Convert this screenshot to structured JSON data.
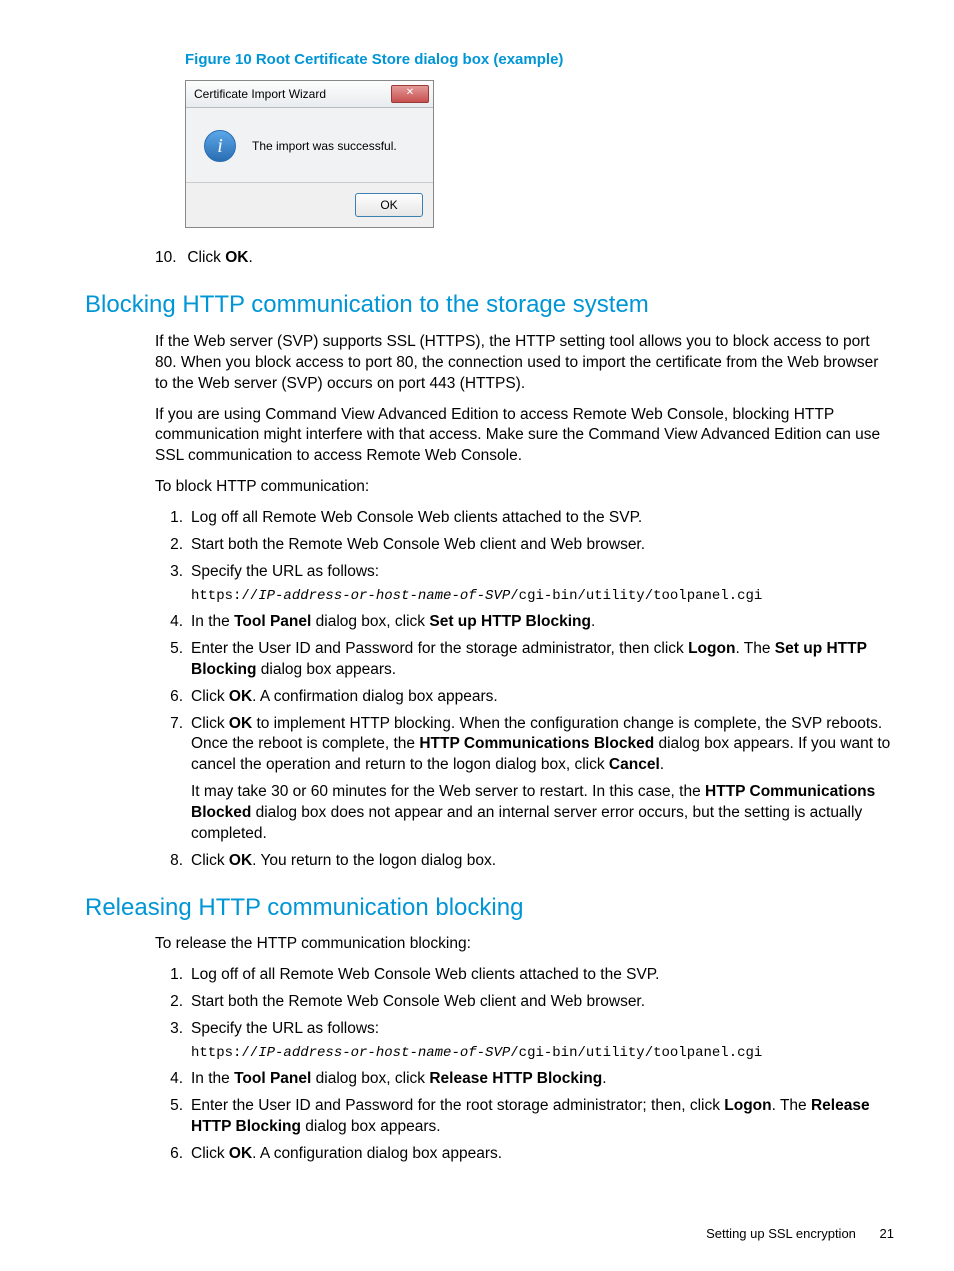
{
  "figure": {
    "caption": "Figure 10 Root Certificate Store dialog box (example)",
    "dialog_title": "Certificate Import Wizard",
    "dialog_message": "The import was successful.",
    "ok_label": "OK"
  },
  "step10": {
    "num": "10.",
    "text_prefix": "Click ",
    "bold": "OK",
    "text_suffix": "."
  },
  "section1": {
    "heading": "Blocking HTTP communication to the storage system",
    "para1": "If the Web server (SVP) supports SSL (HTTPS), the HTTP setting tool allows you to block access to port 80. When you block access to port 80, the connection used to import the certificate from the Web browser to the Web server (SVP) occurs on port 443 (HTTPS).",
    "para2": "If you are using Command View Advanced Edition to access Remote Web Console, blocking HTTP communication might interfere with that access. Make sure the Command View Advanced Edition can use SSL communication to access Remote Web Console.",
    "para3": "To block HTTP communication:",
    "steps": {
      "s1": "Log off all Remote Web Console Web clients attached to the SVP.",
      "s2": "Start both the Remote Web Console Web client and Web browser.",
      "s3_text": "Specify the URL as follows:",
      "s3_url_prefix": "https://",
      "s3_url_italic": "IP-address-or-host-name-of-SVP",
      "s3_url_suffix": "/cgi-bin/utility/toolpanel.cgi",
      "s4_a": "In the ",
      "s4_b1": "Tool Panel",
      "s4_b": " dialog box, click ",
      "s4_b2": "Set up HTTP Blocking",
      "s4_c": ".",
      "s5_a": "Enter the User ID and Password for the storage administrator, then click ",
      "s5_b1": "Logon",
      "s5_b": ". The ",
      "s5_b2": "Set up HTTP Blocking",
      "s5_c": " dialog box appears.",
      "s6_a": "Click ",
      "s6_b1": "OK",
      "s6_b": ". A confirmation dialog box appears.",
      "s7_a": "Click ",
      "s7_b1": "OK",
      "s7_b": " to implement HTTP blocking. When the configuration change is complete, the SVP reboots. Once the reboot is complete, the ",
      "s7_b2": "HTTP Communications Blocked",
      "s7_c": " dialog box appears. If you want to cancel the operation and return to the logon dialog box, click ",
      "s7_b3": "Cancel",
      "s7_d": ".",
      "s7_p2_a": "It may take 30 or 60 minutes for the Web server to restart. In this case, the ",
      "s7_p2_b1": "HTTP Communications Blocked",
      "s7_p2_b": " dialog box does not appear and an internal server error occurs, but the setting is actually completed.",
      "s8_a": "Click ",
      "s8_b1": "OK",
      "s8_b": ". You return to the logon dialog box."
    }
  },
  "section2": {
    "heading": "Releasing HTTP communication blocking",
    "para1": "To release the HTTP communication blocking:",
    "steps": {
      "s1": "Log off of all Remote Web Console Web clients attached to the SVP.",
      "s2": "Start both the Remote Web Console Web client and Web browser.",
      "s3_text": "Specify the URL as follows:",
      "s3_url_prefix": "https://",
      "s3_url_italic": "IP-address-or-host-name-of-SVP",
      "s3_url_suffix": "/cgi-bin/utility/toolpanel.cgi",
      "s4_a": "In the ",
      "s4_b1": "Tool Panel",
      "s4_b": " dialog box, click ",
      "s4_b2": "Release HTTP Blocking",
      "s4_c": ".",
      "s5_a": "Enter the User ID and Password for the root storage administrator; then, click ",
      "s5_b1": "Logon",
      "s5_b": ". The ",
      "s5_b2": "Release HTTP Blocking",
      "s5_c": " dialog box appears.",
      "s6_a": "Click ",
      "s6_b1": "OK",
      "s6_b": ". A configuration dialog box appears."
    }
  },
  "footer": {
    "text": "Setting up SSL encryption",
    "page": "21"
  }
}
